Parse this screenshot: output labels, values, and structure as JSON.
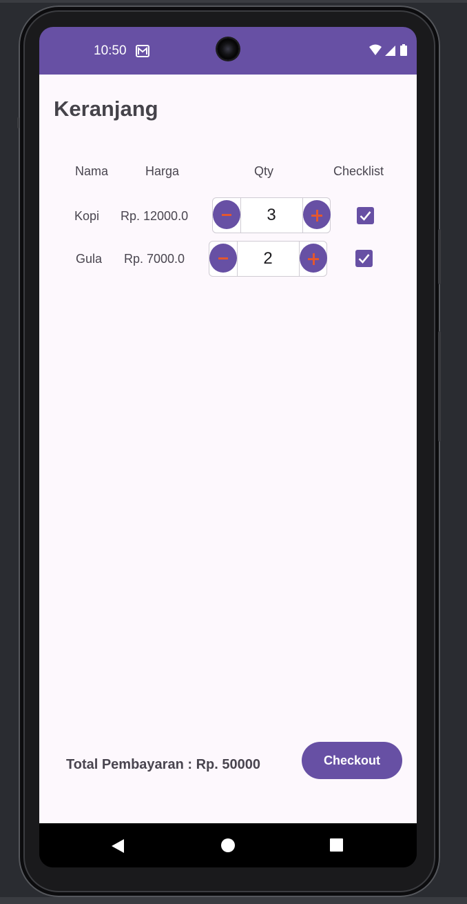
{
  "status_bar": {
    "time": "10:50"
  },
  "page_title": "Keranjang",
  "table": {
    "headers": [
      "Nama",
      "Harga",
      "Qty",
      "Checklist"
    ],
    "rows": [
      {
        "name": "Kopi",
        "price": "Rp. 12000.0",
        "qty": "3",
        "checked": true
      },
      {
        "name": "Gula",
        "price": "Rp. 7000.0",
        "qty": "2",
        "checked": true
      }
    ]
  },
  "footer": {
    "total_label": "Total Pembayaran : Rp. 50000",
    "checkout_label": "Checkout"
  },
  "colors": {
    "primary": "#6750a4",
    "accent": "#e4572e",
    "background": "#fdf8fd"
  },
  "icons": [
    "mail-icon",
    "wifi-icon",
    "cellular-signal-icon",
    "battery-icon",
    "minus-icon",
    "plus-icon",
    "checkmark-icon",
    "nav-back-icon",
    "nav-home-icon",
    "nav-recents-icon"
  ]
}
